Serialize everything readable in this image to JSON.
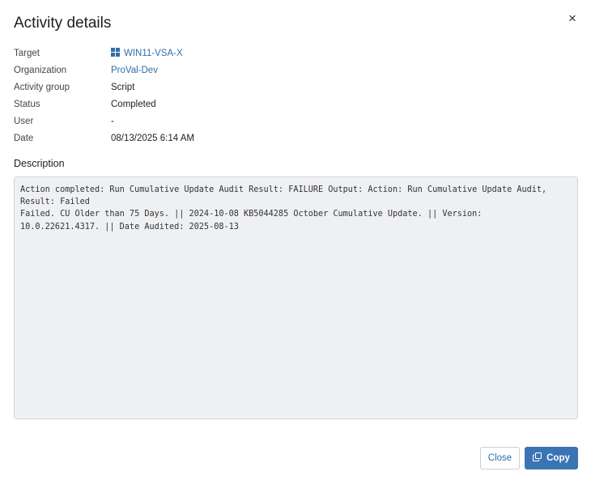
{
  "dialog": {
    "title": "Activity details",
    "close_glyph": "×"
  },
  "details": {
    "target": {
      "label": "Target",
      "value": "WIN11-VSA-X",
      "icon": "windows-icon"
    },
    "organization": {
      "label": "Organization",
      "value": "ProVal-Dev"
    },
    "activity_group": {
      "label": "Activity group",
      "value": "Script"
    },
    "status": {
      "label": "Status",
      "value": "Completed"
    },
    "user": {
      "label": "User",
      "value": "-"
    },
    "date": {
      "label": "Date",
      "value": "08/13/2025 6:14 AM"
    }
  },
  "description": {
    "heading": "Description",
    "text": "Action completed: Run Cumulative Update Audit Result: FAILURE Output: Action: Run Cumulative Update Audit,\nResult: Failed\nFailed. CU Older than 75 Days. || 2024-10-08 KB5044285 October Cumulative Update. || Version:\n10.0.22621.4317. || Date Audited: 2025-08-13"
  },
  "footer": {
    "close_label": "Close",
    "copy_label": "Copy",
    "copy_icon": "copy-icon"
  },
  "colors": {
    "link": "#2f6ea8",
    "primary": "#3a74b4",
    "desc_bg": "#eff0f2"
  }
}
